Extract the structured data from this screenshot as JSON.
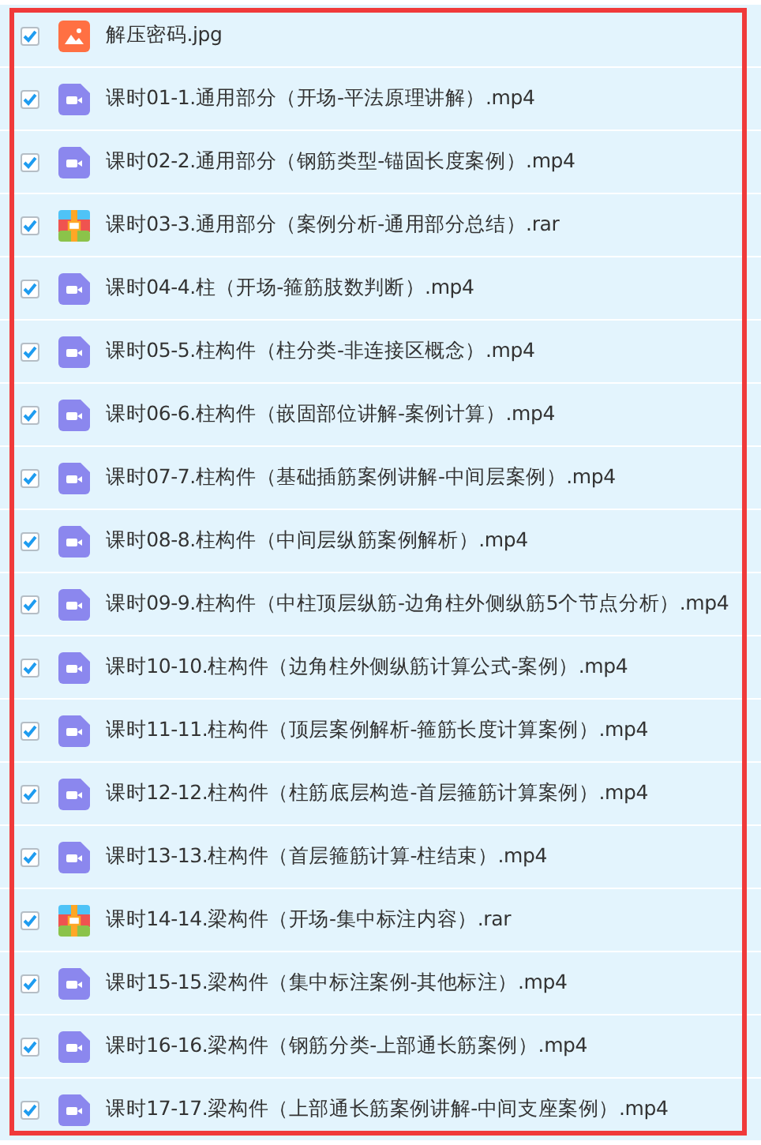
{
  "files": [
    {
      "name": "解压密码.jpg",
      "kind": "image",
      "checked": true
    },
    {
      "name": "课时01-1.通用部分（开场-平法原理讲解）.mp4",
      "kind": "video",
      "checked": true
    },
    {
      "name": "课时02-2.通用部分（钢筋类型-锚固长度案例）.mp4",
      "kind": "video",
      "checked": true
    },
    {
      "name": "课时03-3.通用部分（案例分析-通用部分总结）.rar",
      "kind": "archive",
      "checked": true
    },
    {
      "name": "课时04-4.柱（开场-箍筋肢数判断）.mp4",
      "kind": "video",
      "checked": true
    },
    {
      "name": "课时05-5.柱构件（柱分类-非连接区概念）.mp4",
      "kind": "video",
      "checked": true
    },
    {
      "name": "课时06-6.柱构件（嵌固部位讲解-案例计算）.mp4",
      "kind": "video",
      "checked": true
    },
    {
      "name": "课时07-7.柱构件（基础插筋案例讲解-中间层案例）.mp4",
      "kind": "video",
      "checked": true
    },
    {
      "name": "课时08-8.柱构件（中间层纵筋案例解析）.mp4",
      "kind": "video",
      "checked": true
    },
    {
      "name": "课时09-9.柱构件（中柱顶层纵筋-边角柱外侧纵筋5个节点分析）.mp4",
      "kind": "video",
      "checked": true
    },
    {
      "name": "课时10-10.柱构件（边角柱外侧纵筋计算公式-案例）.mp4",
      "kind": "video",
      "checked": true
    },
    {
      "name": "课时11-11.柱构件（顶层案例解析-箍筋长度计算案例）.mp4",
      "kind": "video",
      "checked": true
    },
    {
      "name": "课时12-12.柱构件（柱筋底层构造-首层箍筋计算案例）.mp4",
      "kind": "video",
      "checked": true
    },
    {
      "name": "课时13-13.柱构件（首层箍筋计算-柱结束）.mp4",
      "kind": "video",
      "checked": true
    },
    {
      "name": "课时14-14.梁构件（开场-集中标注内容）.rar",
      "kind": "archive",
      "checked": true
    },
    {
      "name": "课时15-15.梁构件（集中标注案例-其他标注）.mp4",
      "kind": "video",
      "checked": true
    },
    {
      "name": "课时16-16.梁构件（钢筋分类-上部通长筋案例）.mp4",
      "kind": "video",
      "checked": true
    },
    {
      "name": "课时17-17.梁构件（上部通长筋案例讲解-中间支座案例）.mp4",
      "kind": "video",
      "checked": true
    }
  ]
}
